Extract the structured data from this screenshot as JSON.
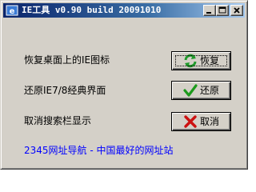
{
  "window": {
    "title": "IE工具 v0.90 build 20091010",
    "icon": "ie-tool-icon",
    "controls": {
      "minimize": "minimize-icon",
      "maximize": "maximize-icon",
      "close": "close-icon"
    }
  },
  "rows": [
    {
      "label": "恢复桌面上的IE图标",
      "button": {
        "label": "恢复",
        "icon": "refresh-icon",
        "icon_color": "#1f9a2a"
      }
    },
    {
      "label": "还原IE7/8经典界面",
      "button": {
        "label": "还原",
        "icon": "checkmark-icon",
        "icon_color": "#1c9a1c"
      }
    },
    {
      "label": "取消搜索栏显示",
      "button": {
        "label": "取消",
        "icon": "x-mark-icon",
        "icon_color": "#cc1111"
      }
    }
  ],
  "footer": {
    "link_text": "2345网址导航 - 中国最好的网址站",
    "link_color": "#0000ff"
  },
  "colors": {
    "face": "#d4d0c8",
    "title_start": "#0a246a",
    "title_end": "#a6caf0"
  }
}
